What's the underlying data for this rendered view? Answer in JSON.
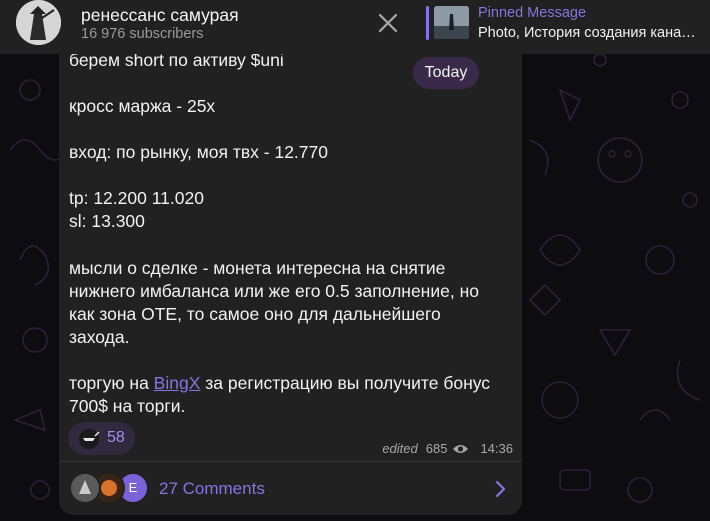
{
  "header": {
    "channel_title": "ренессанс самурая",
    "subscribers": "16 976 subscribers"
  },
  "pinned": {
    "title": "Pinned Message",
    "text": "Photo, История создания кана…"
  },
  "date_pill": "Today",
  "message": {
    "line1": "берем short по активу $uni",
    "line2": "кросс маржа - 25х",
    "line3": "вход: по рынку, моя твх - 12.770",
    "line4": "tp: 12.200 11.020",
    "line5": "sl: 13.300",
    "line6": "мысли о сделке - монета интересна на снятие",
    "line7": "нижнего имбаланса или же его 0.5 заполнение, но",
    "line8": "как зона ОТЕ, то самое оно для дальнейшего",
    "line9": "захода.",
    "line10_prefix": "торгую на ",
    "line10_link": "BingX",
    "line10_suffix": " за регистрацию вы получите бонус",
    "line11": "700$ на торги."
  },
  "reaction": {
    "count": "58"
  },
  "meta": {
    "edited": "edited",
    "views": "685",
    "time": "14:36"
  },
  "comments": {
    "avatar_letter": "E",
    "label": "27 Comments"
  },
  "colors": {
    "accent": "#8774e1",
    "bubble": "#212121",
    "header": "#212121"
  }
}
